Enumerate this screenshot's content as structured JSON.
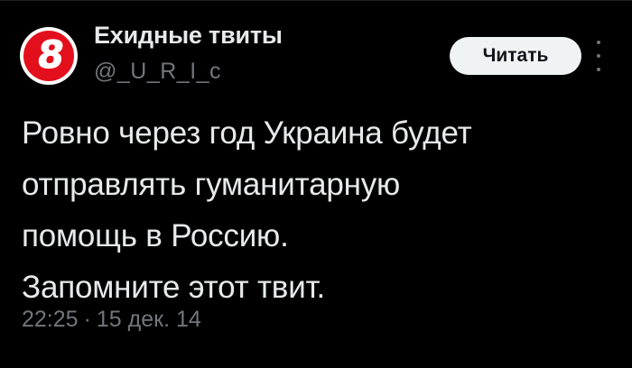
{
  "author": {
    "display_name": "Ехидные твиты",
    "handle": "@_U_R_I_c",
    "avatar_icon": "tv-channel-8-logo-icon",
    "avatar_text": "8"
  },
  "actions": {
    "read_label": "Читать",
    "more_icon": "more-vertical-icon"
  },
  "tweet": {
    "lines": [
      "Ровно через год Украина будет",
      "отправлять гуманитарную",
      "помощь в Россию.",
      "Запомните этот твит."
    ],
    "time": "22:25",
    "separator": "·",
    "date": "15 дек. 14"
  },
  "colors": {
    "background": "#000000",
    "text": "#e7e9ea",
    "muted": "#71767b",
    "button_bg": "#eff3f4",
    "avatar_red": "#e30f1c"
  }
}
